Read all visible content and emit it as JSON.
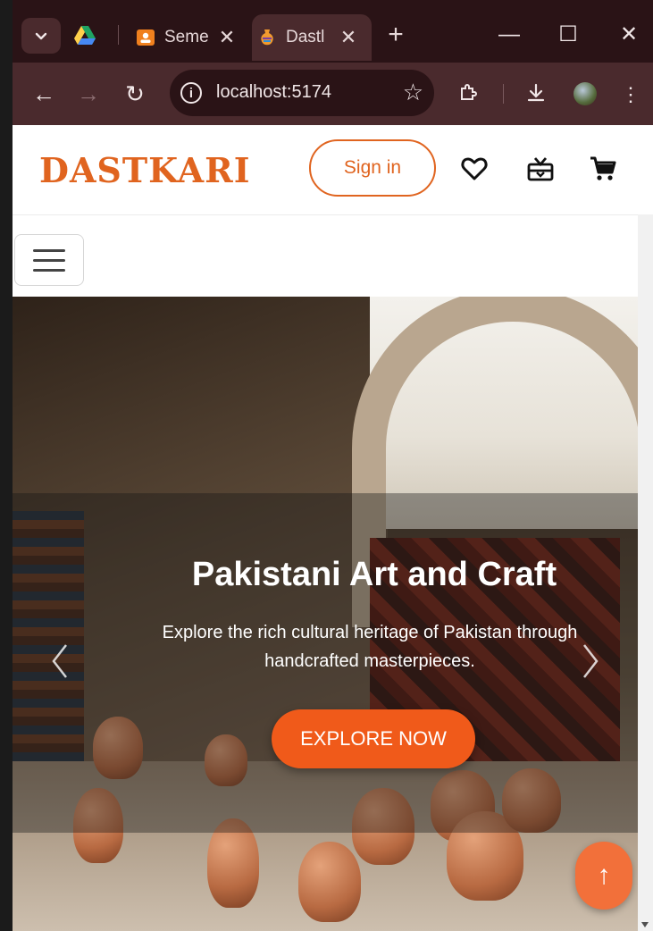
{
  "browser": {
    "tabs": [
      {
        "label": "Seme",
        "favicon": "person-card-icon",
        "active": false
      },
      {
        "label": "Dastl",
        "favicon": "vase-icon",
        "active": true
      }
    ],
    "address": "localhost:5174",
    "colors": {
      "frame": "#2a1316",
      "toolbar": "#4a2a2d"
    }
  },
  "site": {
    "logo": "DASTKARI",
    "signin_label": "Sign in",
    "colors": {
      "brand": "#e0641f",
      "cta": "#f05a1a"
    }
  },
  "hero": {
    "title": "Pakistani Art and Craft",
    "subtitle": "Explore the rich cultural heritage of Pakistan through handcrafted masterpieces.",
    "cta_label": "EXPLORE NOW",
    "fab_glyph": "↑"
  }
}
